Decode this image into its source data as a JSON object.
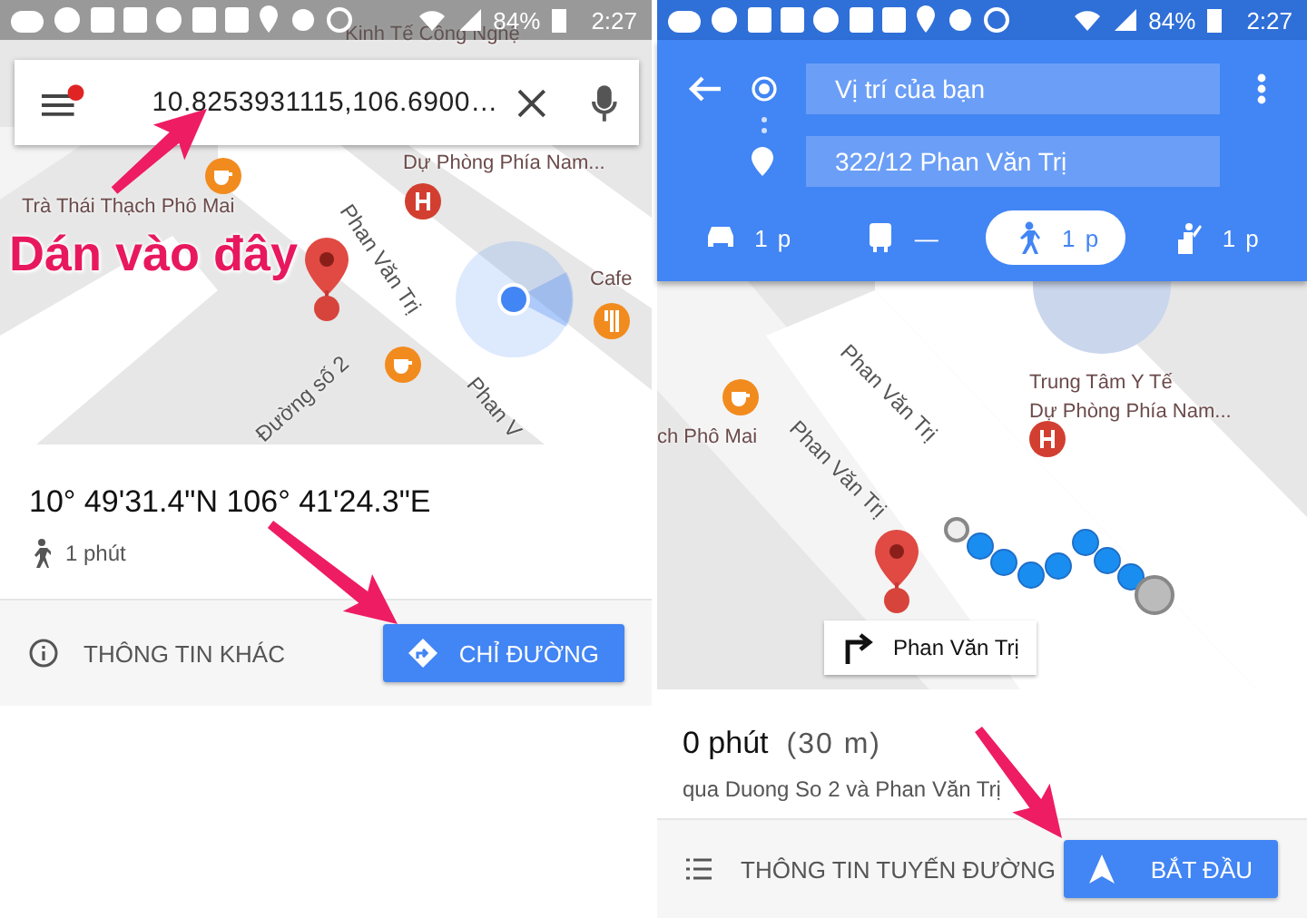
{
  "left_screen": {
    "status_bar": {
      "battery": "84%",
      "time": "2:27"
    },
    "search": {
      "value": "10.8253931115,106.6900…"
    },
    "map_labels": [
      {
        "kind": "place",
        "text": "Kinh Tế Công Nghệ"
      },
      {
        "kind": "place",
        "text": "Dự Phòng Phía Nam..."
      },
      {
        "kind": "place",
        "text": "Trà Thái Thạch Phô Mai"
      },
      {
        "kind": "street",
        "text": "Phan Văn Trị"
      },
      {
        "kind": "place",
        "text": "Cafe"
      },
      {
        "kind": "street",
        "text": "Đường số 2"
      },
      {
        "kind": "street",
        "text": "Phan V"
      }
    ],
    "place": {
      "coordinates": "10° 49'31.4\"N 106° 41'24.3\"E",
      "walk_time": "1 phút"
    },
    "actions": {
      "more_info": "THÔNG TIN KHÁC",
      "directions": "CHỈ ĐƯỜNG"
    }
  },
  "annotation": {
    "text": "Dán vào đây"
  },
  "right_screen": {
    "status_bar": {
      "battery": "84%",
      "time": "2:27"
    },
    "origin": "Vị trí của bạn",
    "destination": "322/12 Phan Văn Trị",
    "modes": [
      {
        "kind": "car",
        "label": "1 p",
        "selected": false
      },
      {
        "kind": "transit",
        "label": "—",
        "selected": false
      },
      {
        "kind": "walk",
        "label": "1 p",
        "selected": true
      },
      {
        "kind": "ride",
        "label": "1 p",
        "selected": false
      }
    ],
    "map_labels": [
      {
        "kind": "street",
        "text": "Phan Văn Trị"
      },
      {
        "kind": "place",
        "text": "Trung Tâm Y Tế"
      },
      {
        "kind": "place",
        "text": "Dự Phòng Phía Nam..."
      },
      {
        "kind": "place",
        "text": "ch Phô Mai"
      },
      {
        "kind": "street",
        "text": "Phan Văn Trị"
      }
    ],
    "turn_callout": "Phan Văn Trị",
    "summary": {
      "duration": "0 phút",
      "distance": "(30 m)",
      "via": "qua Duong So 2 và Phan Văn Trị"
    },
    "actions": {
      "route_info": "THÔNG TIN TUYẾN ĐƯỜNG",
      "start": "BẮT ĐẦU"
    }
  }
}
